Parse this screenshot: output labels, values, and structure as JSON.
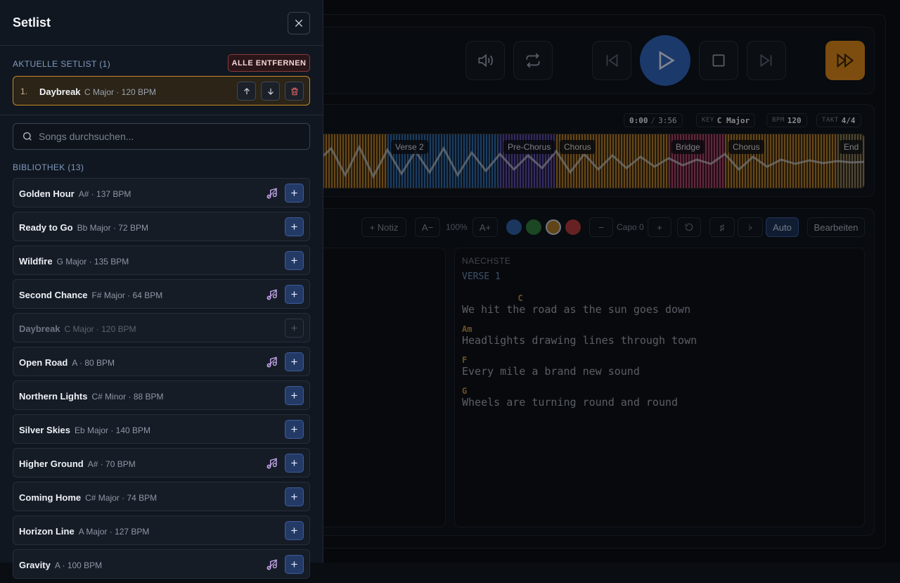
{
  "transport": {
    "time": "0:00",
    "duration": "3:56",
    "key_label": "KEY",
    "key": "C Major",
    "bpm_label": "BPM",
    "bpm": "120",
    "takt_label": "TAKT",
    "takt": "4/4"
  },
  "waveform": {
    "sections": [
      "Verse 2",
      "Pre-Chorus",
      "Chorus",
      "Bridge",
      "Chorus",
      "End"
    ]
  },
  "editor": {
    "add_note": "+ Notiz",
    "font_minus": "A−",
    "zoom": "100%",
    "font_plus": "A+",
    "capo_minus": "−",
    "capo": "Capo 0",
    "capo_plus": "+",
    "sharp": "♯",
    "flat": "♭",
    "auto": "Auto",
    "edit": "Bearbeiten",
    "colors": [
      "#2f5fa6",
      "#2f7a3d",
      "#a8782c",
      "#b03b3b"
    ]
  },
  "next": {
    "label": "NAECHSTE",
    "section": "VERSE 1",
    "lines": [
      {
        "chord": "           C",
        "lyric": "We hit the road as the sun goes down"
      },
      {
        "chord": "Am",
        "lyric": "Headlights drawing lines through town"
      },
      {
        "chord": "F",
        "lyric": "Every mile a brand new sound"
      },
      {
        "chord": "G",
        "lyric": "Wheels are turning round and round"
      }
    ]
  },
  "sidebar": {
    "title": "Setlist",
    "current_label": "AKTUELLE SETLIST (1)",
    "remove_all": "ALLE ENTFERNEN",
    "current": [
      {
        "num": "1.",
        "name": "Daybreak",
        "meta": "C Major · 120 BPM"
      }
    ],
    "search_placeholder": "Songs durchsuchen...",
    "library_label": "BIBLIOTHEK (13)",
    "library": [
      {
        "name": "Golden Hour",
        "meta": "A# · 137 BPM",
        "has_audio": true,
        "in_setlist": false
      },
      {
        "name": "Ready to Go",
        "meta": "Bb Major · 72 BPM",
        "has_audio": false,
        "in_setlist": false
      },
      {
        "name": "Wildfire",
        "meta": "G Major · 135 BPM",
        "has_audio": false,
        "in_setlist": false
      },
      {
        "name": "Second Chance",
        "meta": "F# Major · 64 BPM",
        "has_audio": true,
        "in_setlist": false
      },
      {
        "name": "Daybreak",
        "meta": "C Major · 120 BPM",
        "has_audio": false,
        "in_setlist": true
      },
      {
        "name": "Open Road",
        "meta": "A · 80 BPM",
        "has_audio": true,
        "in_setlist": false
      },
      {
        "name": "Northern Lights",
        "meta": "C# Minor · 88 BPM",
        "has_audio": false,
        "in_setlist": false
      },
      {
        "name": "Silver Skies",
        "meta": "Eb Major · 140 BPM",
        "has_audio": false,
        "in_setlist": false
      },
      {
        "name": "Higher Ground",
        "meta": "A# · 70 BPM",
        "has_audio": true,
        "in_setlist": false
      },
      {
        "name": "Coming Home",
        "meta": "C# Major · 74 BPM",
        "has_audio": false,
        "in_setlist": false
      },
      {
        "name": "Horizon Line",
        "meta": "A Major · 127 BPM",
        "has_audio": false,
        "in_setlist": false
      },
      {
        "name": "Gravity",
        "meta": "A · 100 BPM",
        "has_audio": true,
        "in_setlist": false
      }
    ]
  }
}
